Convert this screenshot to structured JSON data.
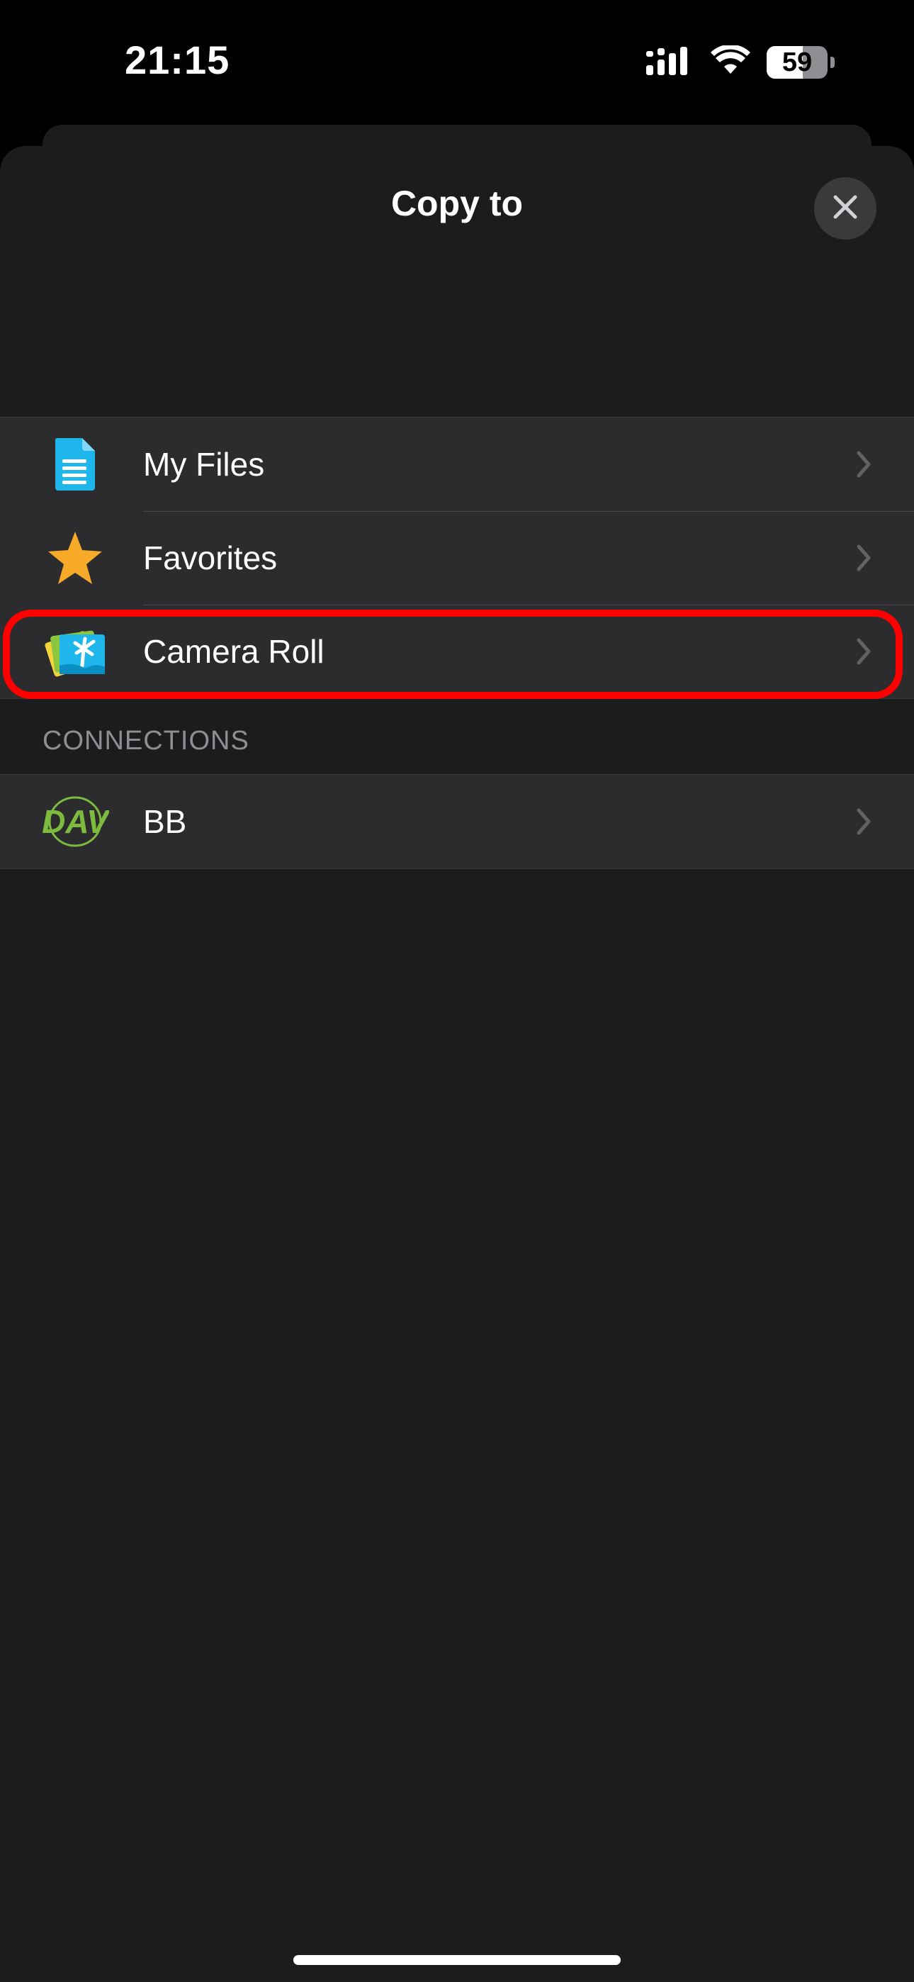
{
  "status_bar": {
    "time": "21:15",
    "battery_level": "59",
    "battery_fraction": 0.59,
    "icons": [
      "cellular-signal-icon",
      "wifi-icon",
      "battery-icon"
    ]
  },
  "sheet": {
    "title": "Copy to",
    "close_icon": "close-icon"
  },
  "locations": [
    {
      "label": "My Files",
      "icon": "document-icon",
      "color": "#1fb6ec"
    },
    {
      "label": "Favorites",
      "icon": "star-icon",
      "color": "#f7a928"
    },
    {
      "label": "Camera Roll",
      "icon": "photos-icon",
      "highlighted": true
    }
  ],
  "connections": {
    "header": "CONNECTIONS",
    "items": [
      {
        "label": "BB",
        "icon": "webdav-icon",
        "icon_text": "DAV",
        "color": "#7dbb3f"
      }
    ]
  },
  "colors": {
    "background": "#1c1c1e",
    "row_background": "#2c2c2e",
    "highlight": "#ff0000"
  }
}
